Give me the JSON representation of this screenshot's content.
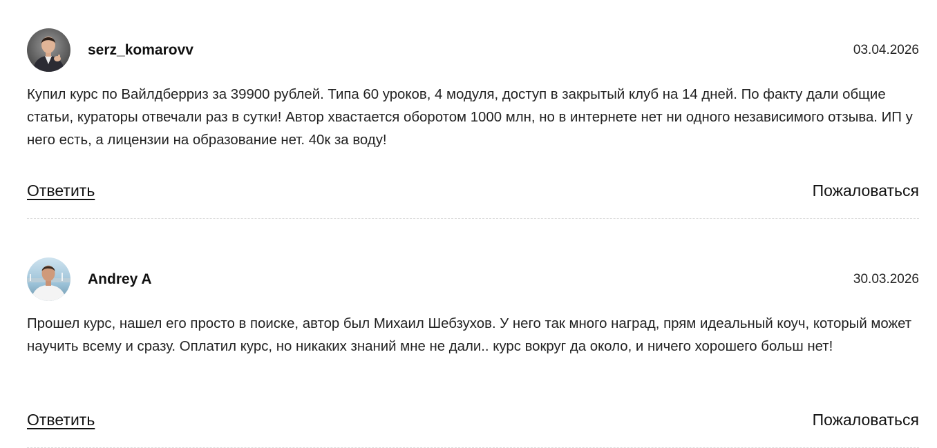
{
  "comments": [
    {
      "username": "serz_komarovv",
      "date": "03.04.2026",
      "text": "Купил курс по Вайлдберриз за 39900 рублей. Типа 60 уроков, 4 модуля, доступ в закрытый клуб на 14 дней. По факту дали общие статьи, кураторы отвечали раз в сутки! Автор хвастается оборотом 1000 млн, но в интернете нет ни одного независимого отзыва. ИП у него есть, а лицензии на образование нет. 40к за воду!",
      "reply_label": "Ответить",
      "report_label": "Пожаловаться",
      "avatar_icon": "user-photo-avatar"
    },
    {
      "username": "Andrey A",
      "date": "30.03.2026",
      "text": "Прошел курс, нашел его просто в поиске, автор был Михаил Шебзухов. У него так много наград, прям идеальный коуч, который может научить всему и сразу. Оплатил курс, но никаких знаний мне не дали.. курс вокруг да около, и ничего хорошего больш нет!",
      "reply_label": "Ответить",
      "report_label": "Пожаловаться",
      "avatar_icon": "user-photo-avatar"
    }
  ],
  "colors": {
    "text": "#222222",
    "divider": "#dcdcdc",
    "background": "#ffffff"
  }
}
